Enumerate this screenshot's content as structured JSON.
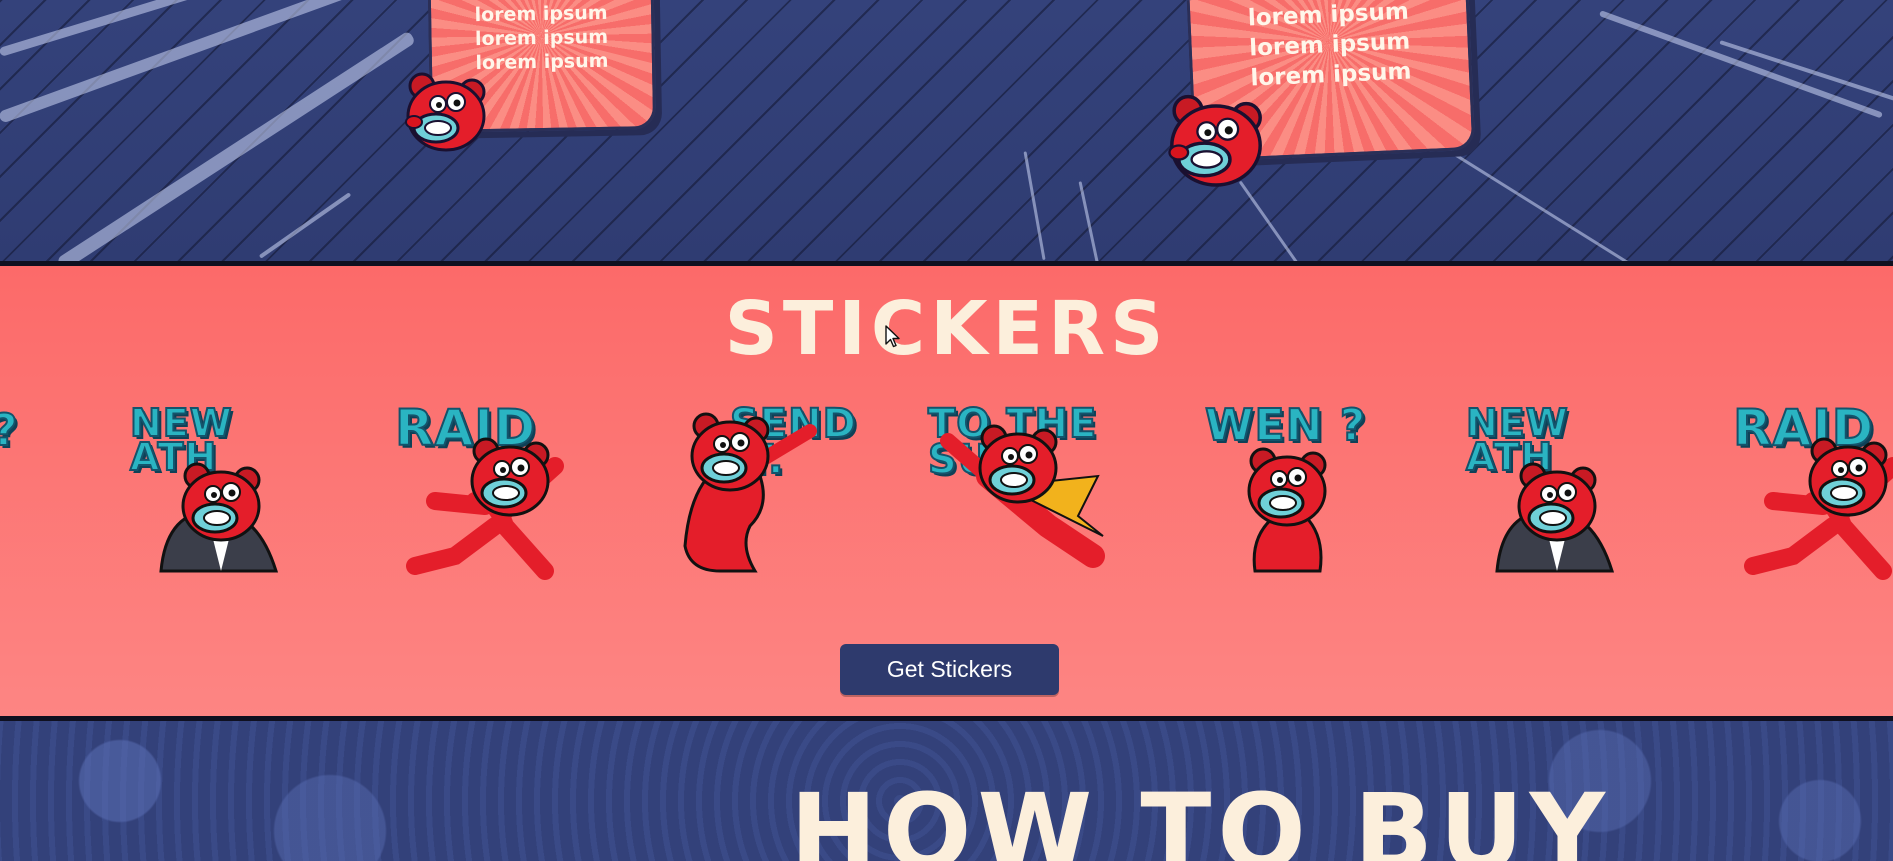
{
  "hero": {
    "cards": [
      {
        "lines": [
          "lorem ipsum",
          "lorem ipsum",
          "lorem ipsum"
        ]
      },
      {
        "lines": [
          "lorem ipsum",
          "lorem ipsum",
          "lorem ipsum"
        ]
      }
    ]
  },
  "stickers": {
    "title": "STICKERS",
    "items": [
      {
        "caption": "? ",
        "icon": "wen-sticker-partial"
      },
      {
        "caption": "NEW ATH",
        "icon": "new-ath-sticker"
      },
      {
        "caption": "RAID",
        "icon": "raid-sticker"
      },
      {
        "caption": "SEND IT.",
        "icon": "send-it-sticker"
      },
      {
        "caption": "TO THE SUN",
        "icon": "to-the-sun-sticker"
      },
      {
        "caption": "WEN ?",
        "icon": "wen-sticker"
      },
      {
        "caption": "NEW ATH",
        "icon": "new-ath-sticker"
      },
      {
        "caption": "RAID",
        "icon": "raid-sticker-partial"
      }
    ],
    "button_label": "Get Stickers"
  },
  "howto": {
    "title": "HOW TO BUY"
  },
  "colors": {
    "navy": "#2f3d75",
    "coral": "#fc6a69",
    "cream": "#fcefdc",
    "teal": "#2ab4c2",
    "mascot_red": "#e41e2a"
  }
}
